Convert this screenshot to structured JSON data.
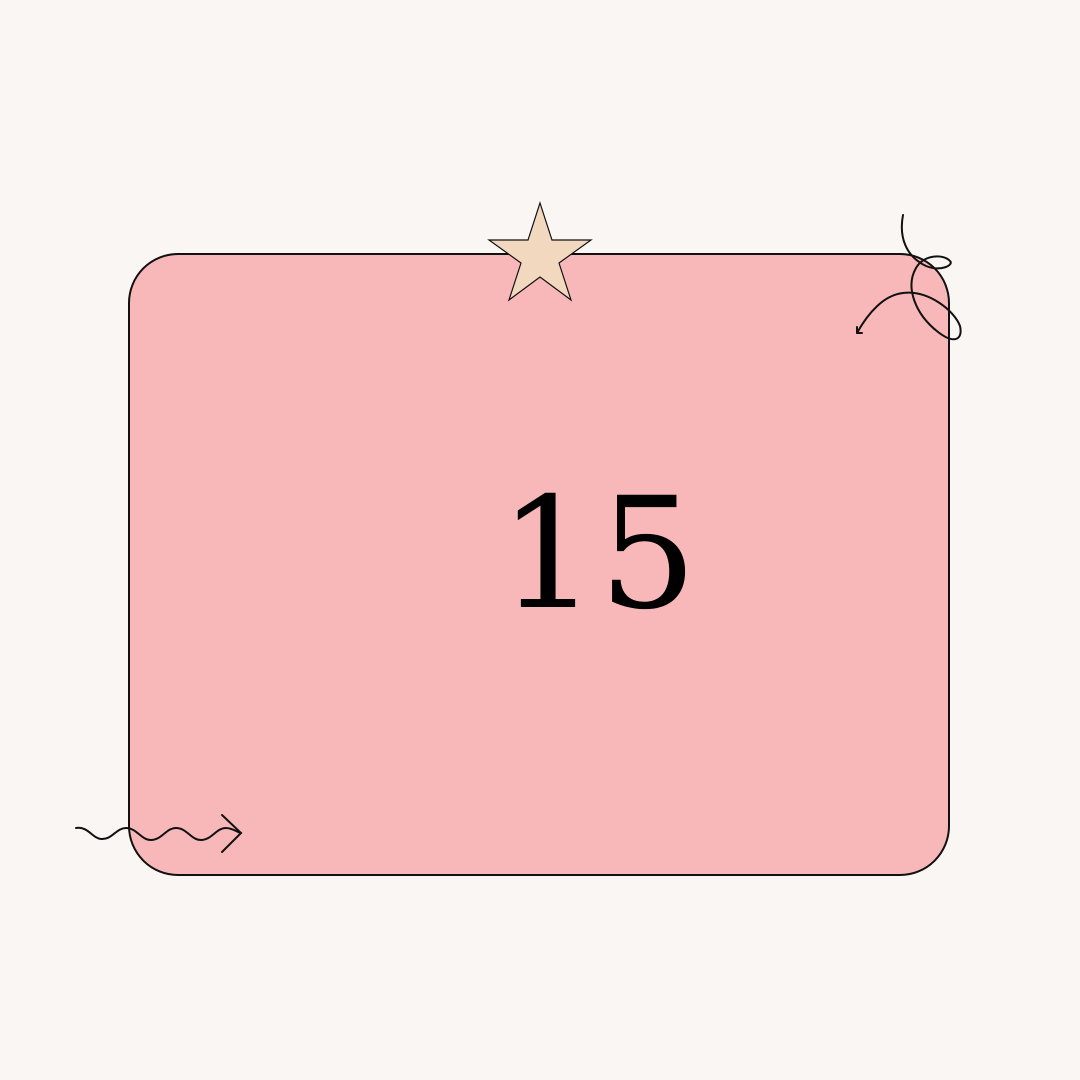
{
  "card": {
    "number": "15",
    "fill_color": "#F8B8B9",
    "border_color": "#111111"
  },
  "page": {
    "background_color": "#FAF6F3"
  },
  "decorations": {
    "star": {
      "icon": "star-icon",
      "fill_color": "#F3D8C0"
    },
    "loop_arrow": {
      "icon": "curly-loop-arrow-icon"
    },
    "wavy_arrow": {
      "icon": "wavy-arrow-icon"
    }
  }
}
